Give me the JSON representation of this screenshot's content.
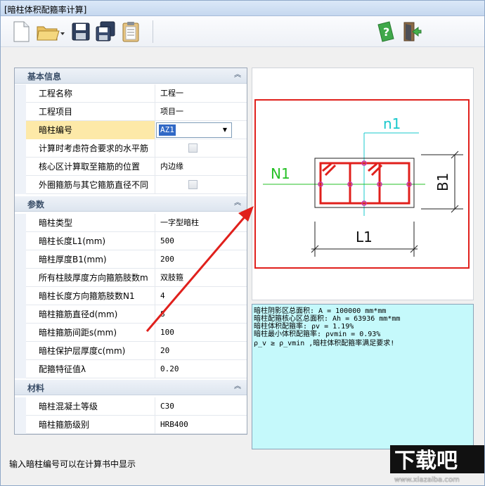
{
  "window": {
    "title": "[暗柱体积配箍率计算]"
  },
  "toolbar": {
    "buttons": [
      "new-file-icon",
      "open-folder-icon",
      "save-icon",
      "save-as-icon",
      "clipboard-icon",
      "help-icon",
      "exit-icon"
    ]
  },
  "propgrid": {
    "sections": [
      {
        "label": "基本信息",
        "rows": [
          {
            "name": "工程名称",
            "value": "工程一"
          },
          {
            "name": "工程项目",
            "value": "项目一"
          },
          {
            "name": "暗柱编号",
            "value": "AZ1"
          },
          {
            "name": "计算时考虑符合要求的水平筋",
            "value": ""
          },
          {
            "name": "核心区计算取至箍筋的位置",
            "value": "内边缘"
          },
          {
            "name": "外圈箍筋与其它箍筋直径不同",
            "value": ""
          }
        ]
      },
      {
        "label": "参数",
        "rows": [
          {
            "name": "暗柱类型",
            "value": "一字型暗柱"
          },
          {
            "name": "暗柱长度L1(mm)",
            "value": "500"
          },
          {
            "name": "暗柱厚度B1(mm)",
            "value": "200"
          },
          {
            "name": "所有柱肢厚度方向箍筋肢数m",
            "value": "双肢箍"
          },
          {
            "name": "暗柱长度方向箍筋肢数N1",
            "value": "4"
          },
          {
            "name": "暗柱箍筋直径d(mm)",
            "value": "8"
          },
          {
            "name": "暗柱箍筋间距s(mm)",
            "value": "100"
          },
          {
            "name": "暗柱保护层厚度c(mm)",
            "value": "20"
          },
          {
            "name": "配箍特征值λ",
            "value": "0.20"
          }
        ]
      },
      {
        "label": "材料",
        "rows": [
          {
            "name": "暗柱混凝土等级",
            "value": "C30"
          },
          {
            "name": "暗柱箍筋级别",
            "value": "HRB400"
          }
        ]
      }
    ]
  },
  "diagram": {
    "label_n1": "n1",
    "label_N1": "N1",
    "label_B1": "B1",
    "label_L1": "L1"
  },
  "results": {
    "lines": [
      "暗柱阴影区总面积: A = 100000 mm*mm",
      "暗柱配箍核心区总面积: Ah = 63936 mm*mm",
      "暗柱体积配箍率: ρv = 1.19%",
      "暗柱最小体积配箍率: ρvmin = 0.93%",
      "ρ_v ≥ ρ_vmin ,暗柱体积配箍率满足要求!"
    ]
  },
  "status": {
    "text": "输入暗柱编号可以在计算书中显示"
  },
  "watermark": {
    "logo": "下载吧",
    "url": "www.xiazaiba.com"
  },
  "colors": {
    "accent_red": "#e0201c",
    "highlight_yellow": "#fde9a8",
    "result_bg": "#c5f9fb",
    "cyan_line": "#19c8cc",
    "green_line": "#25c025"
  }
}
